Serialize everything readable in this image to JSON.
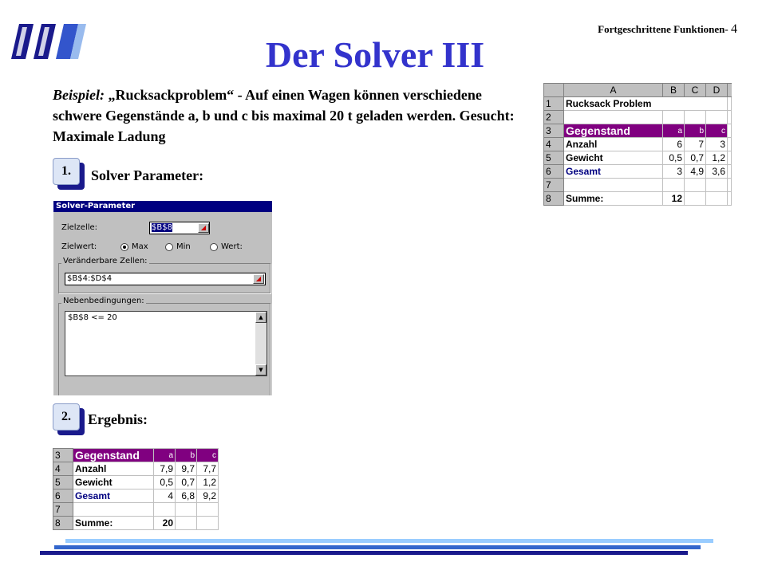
{
  "header": {
    "section": "Fortgeschrittene Funktionen",
    "sep": "-",
    "page": "4"
  },
  "title": "Der Solver III",
  "intro": {
    "lead": "Beispiel:",
    "text": " „Rucksackproblem“ - Auf einen Wagen können verschiedene schwere Gegenstände a, b und c bis maximal 20 t geladen werden. Gesucht: Maximale Ladung"
  },
  "steps": [
    {
      "num": "1.",
      "label": "Solver Parameter:"
    },
    {
      "num": "2.",
      "label": "Ergebnis:"
    }
  ],
  "dialog": {
    "title": "Solver-Parameter",
    "target_label": "Zielzelle:",
    "target_value": "$B$8",
    "goal_label": "Zielwert:",
    "opt_max": "Max",
    "opt_min": "Min",
    "opt_value": "Wert:",
    "changing_group": "Veränderbare Zellen:",
    "changing_value": "$B$4:$D$4",
    "constraints_group": "Nebenbedingungen:",
    "constraint_1": "$B$8 <= 20",
    "pick_icon": "cell-picker-icon"
  },
  "sheet_top": {
    "cols": [
      "A",
      "B",
      "C",
      "D"
    ],
    "rows": [
      {
        "n": "1",
        "a": "Rucksack Problem",
        "b": "",
        "c": "",
        "d": ""
      },
      {
        "n": "2",
        "a": "",
        "b": "",
        "c": "",
        "d": ""
      },
      {
        "n": "3",
        "a": "Gegenstand",
        "b": "a",
        "c": "b",
        "d": "c"
      },
      {
        "n": "4",
        "a": "Anzahl",
        "b": "6",
        "c": "7",
        "d": "3"
      },
      {
        "n": "5",
        "a": "Gewicht",
        "b": "0,5",
        "c": "0,7",
        "d": "1,2"
      },
      {
        "n": "6",
        "a": "Gesamt",
        "b": "3",
        "c": "4,9",
        "d": "3,6"
      },
      {
        "n": "7",
        "a": "",
        "b": "",
        "c": "",
        "d": ""
      },
      {
        "n": "8",
        "a": "Summe:",
        "b": "12",
        "c": "",
        "d": ""
      }
    ]
  },
  "sheet_result": {
    "rows": [
      {
        "n": "3",
        "a": "Gegenstand",
        "b": "a",
        "c": "b",
        "d": "c"
      },
      {
        "n": "4",
        "a": "Anzahl",
        "b": "7,9",
        "c": "9,7",
        "d": "7,7"
      },
      {
        "n": "5",
        "a": "Gewicht",
        "b": "0,5",
        "c": "0,7",
        "d": "1,2"
      },
      {
        "n": "6",
        "a": "Gesamt",
        "b": "4",
        "c": "6,8",
        "d": "9,2"
      },
      {
        "n": "7",
        "a": "",
        "b": "",
        "c": "",
        "d": ""
      },
      {
        "n": "8",
        "a": "Summe:",
        "b": "20",
        "c": "",
        "d": ""
      }
    ]
  },
  "colors": {
    "title": "#3333cc",
    "purple": "#800080",
    "navy": "#000080",
    "lightblue": "#99ccff"
  }
}
